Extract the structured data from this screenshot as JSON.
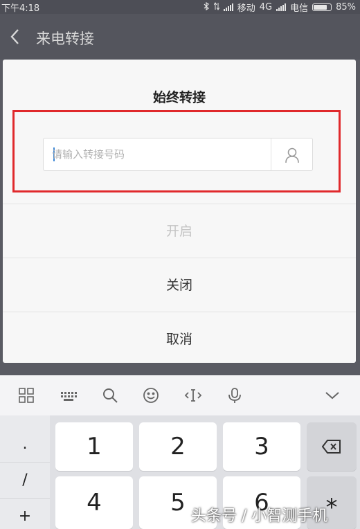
{
  "status_bar": {
    "time": "下午4:18",
    "carrier1": "移动",
    "network": "4G",
    "carrier2": "电信",
    "battery": "85%",
    "battery_level": 0.85
  },
  "header": {
    "title": "来电转接"
  },
  "dialog": {
    "title": "始终转接",
    "input_placeholder": "请输入转接号码",
    "input_value": "",
    "options": {
      "enable": "开启",
      "disable": "关闭",
      "cancel": "取消"
    }
  },
  "keyboard": {
    "toolbar_icons": [
      "grid-icon",
      "keyboard-icon",
      "search-icon",
      "emoji-icon",
      "cursor-icon",
      "microphone-icon",
      "collapse-icon"
    ],
    "side_keys": [
      ".",
      "/",
      "+"
    ],
    "keys": [
      "1",
      "2",
      "3",
      "4",
      "5",
      "6",
      "*"
    ]
  },
  "watermark": "头条号 / 小智测手机",
  "colors": {
    "highlight_box": "#e0292c",
    "caret": "#3b86d6"
  }
}
